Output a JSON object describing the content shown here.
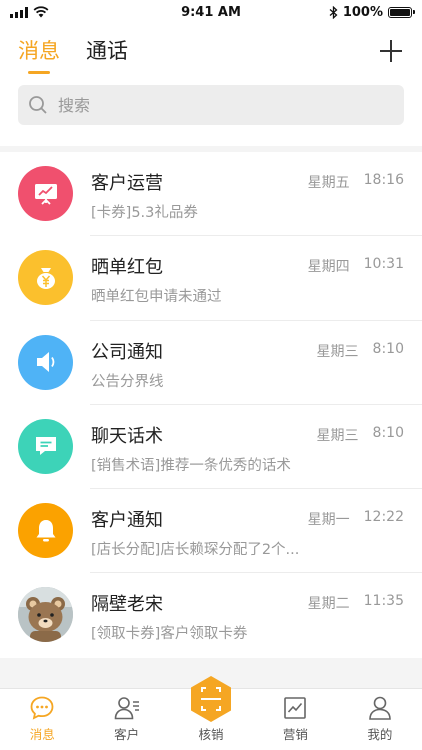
{
  "status_bar": {
    "time": "9:41 AM",
    "battery": "100%"
  },
  "header": {
    "tabs": [
      {
        "label": "消息",
        "active": true
      },
      {
        "label": "通话",
        "active": false
      }
    ],
    "add_icon": "plus-icon"
  },
  "search": {
    "placeholder": "搜索",
    "value": ""
  },
  "conversations": [
    {
      "title": "客户运营",
      "subtitle": "[卡券]5.3礼品券",
      "day": "星期五",
      "time": "18:16",
      "icon": "presentation-icon",
      "color": "#f0506e"
    },
    {
      "title": "晒单红包",
      "subtitle": "晒单红包申请未通过",
      "day": "星期四",
      "time": "10:31",
      "icon": "money-bag-icon",
      "color": "#fbc02d"
    },
    {
      "title": "公司通知",
      "subtitle": "公告分界线",
      "day": "星期三",
      "time": "8:10",
      "icon": "speaker-icon",
      "color": "#4fb3f6"
    },
    {
      "title": "聊天话术",
      "subtitle": "[销售术语]推荐一条优秀的话术",
      "day": "星期三",
      "time": "8:10",
      "icon": "chat-bubble-icon",
      "color": "#3dd3b8"
    },
    {
      "title": "客户通知",
      "subtitle": "[店长分配]店长赖琛分配了2个...",
      "day": "星期一",
      "time": "12:22",
      "icon": "bell-icon",
      "color": "#fba200"
    },
    {
      "title": "隔壁老宋",
      "subtitle": "[领取卡券]客户领取卡券",
      "day": "星期二",
      "time": "11:35",
      "icon": "bear-avatar",
      "color": "#7a6a58"
    }
  ],
  "tabbar": [
    {
      "label": "消息",
      "icon": "message-icon",
      "active": true
    },
    {
      "label": "客户",
      "icon": "contacts-icon",
      "active": false
    },
    {
      "label": "核销",
      "icon": "scan-icon",
      "active": false
    },
    {
      "label": "营销",
      "icon": "chart-icon",
      "active": false
    },
    {
      "label": "我的",
      "icon": "profile-icon",
      "active": false
    }
  ],
  "colors": {
    "accent": "#f5a623"
  }
}
